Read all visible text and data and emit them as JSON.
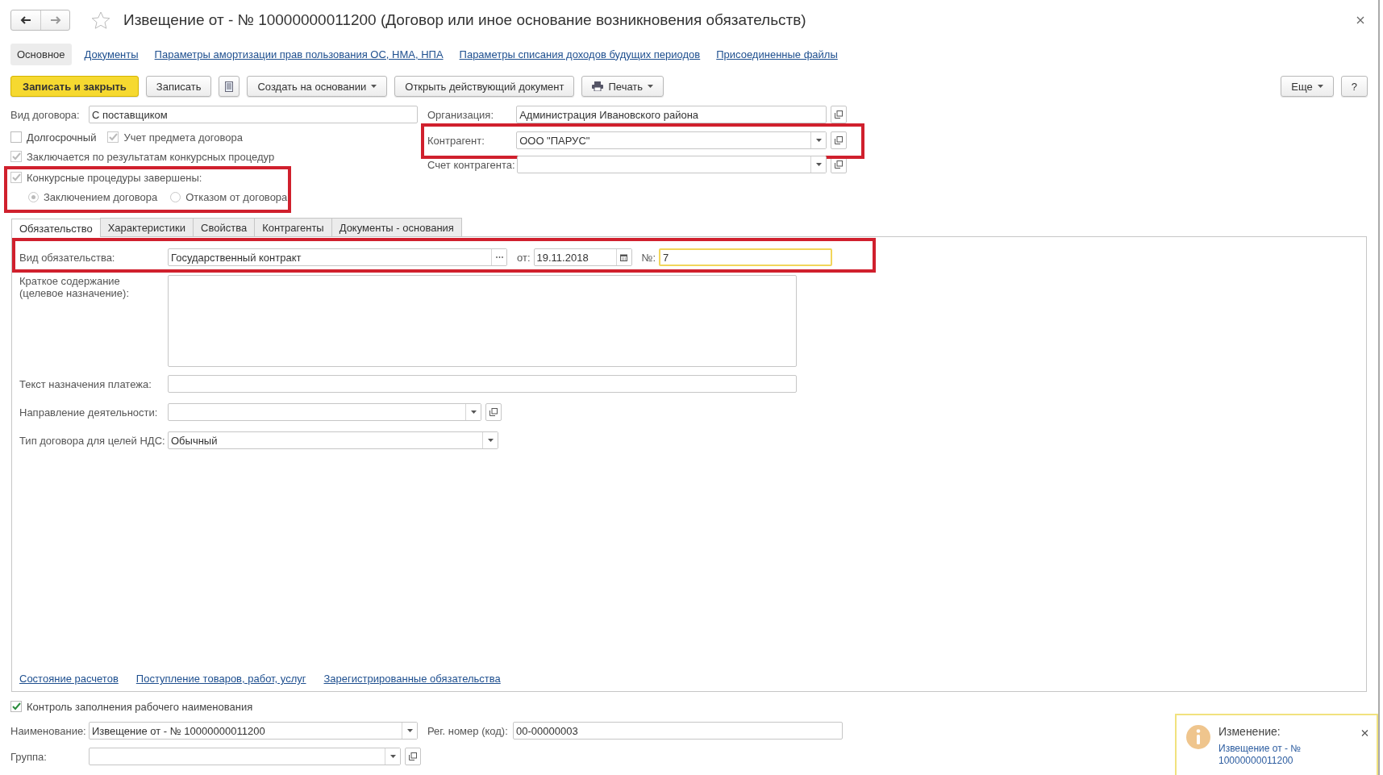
{
  "window": {
    "title": "Извещение от - № 10000000011200 (Договор или иное основание возникновения обязательств)"
  },
  "form_tabs": [
    {
      "label": "Основное",
      "selected": true
    },
    {
      "label": "Документы",
      "selected": false
    },
    {
      "label": "Параметры амортизации прав пользования ОС, НМА, НПА",
      "selected": false
    },
    {
      "label": "Параметры списания доходов будущих периодов",
      "selected": false
    },
    {
      "label": "Присоединенные файлы",
      "selected": false
    }
  ],
  "toolbar": {
    "buttons": [
      {
        "kind": "primary",
        "label": "Записать и закрыть"
      },
      {
        "kind": "plain",
        "label": "Записать"
      },
      {
        "kind": "icon"
      },
      {
        "kind": "menu",
        "label": "Создать на основании"
      },
      {
        "kind": "plain",
        "label": "Открыть действующий документ"
      },
      {
        "kind": "print",
        "label": "Печать"
      }
    ],
    "right_buttons": [
      {
        "kind": "menu",
        "label": "Еще"
      },
      {
        "kind": "plain",
        "label": "?"
      }
    ]
  },
  "contract_type": {
    "label": "Вид договора:",
    "value": "С поставщиком"
  },
  "options": [
    {
      "label": "Долгосрочный",
      "checked": false,
      "disabled": false
    },
    {
      "label": "Учет предмета договора",
      "checked": true,
      "disabled": true
    }
  ],
  "by_competition": {
    "label": "Заключается по результатам конкурсных процедур",
    "checked": true,
    "disabled": true
  },
  "competition_done": {
    "highlighted": true,
    "label": "Конкурсные процедуры завершены:",
    "checked": true,
    "disabled": true,
    "outcomes": [
      {
        "label": "Заключением договора",
        "selected": true
      },
      {
        "label": "Отказом от договора",
        "selected": false
      }
    ]
  },
  "organization": {
    "label": "Организация:",
    "value": "Администрация Ивановского района"
  },
  "counterparty": {
    "label": "Контрагент:",
    "value": "ООО \"ПАРУС\"",
    "highlighted": true
  },
  "counterparty_account": {
    "label": "Счет контрагента:"
  },
  "tabs": [
    {
      "label": "Обязательство",
      "selected": true
    },
    {
      "label": "Характеристики",
      "selected": false
    },
    {
      "label": "Свойства",
      "selected": false
    },
    {
      "label": "Контрагенты",
      "selected": false
    },
    {
      "label": "Документы - основания",
      "selected": false
    }
  ],
  "obligation": {
    "highlighted": true,
    "type_label": "Вид обязательства:",
    "type_value": "Государственный контракт",
    "date_label": "от:",
    "date_value": "19.11.2018",
    "number_label": "№:",
    "number_value": "7",
    "number_focused": true
  },
  "summary": {
    "label": "Краткое содержание (целевое назначение):"
  },
  "payment_text": {
    "label": "Текст назначения платежа:"
  },
  "activity": {
    "label": "Направление деятельности:"
  },
  "vat_type": {
    "label": "Тип договора для целей НДС:",
    "value": "Обычный"
  },
  "links": [
    "Состояние расчетов",
    "Поступление товаров, работ, услуг",
    "Зарегистрированные обязательства"
  ],
  "name_control": {
    "label": "Контроль заполнения рабочего наименования",
    "checked": true,
    "disabled": false
  },
  "name": {
    "label": "Наименование:",
    "value": "Извещение от - № 10000000011200"
  },
  "reg_number": {
    "label": "Рег. номер (код):",
    "value": "00-00000003"
  },
  "group": {
    "label": "Группа:"
  },
  "notification": {
    "title": "Изменение:",
    "link": "Извещение от - № 10000000011200"
  }
}
